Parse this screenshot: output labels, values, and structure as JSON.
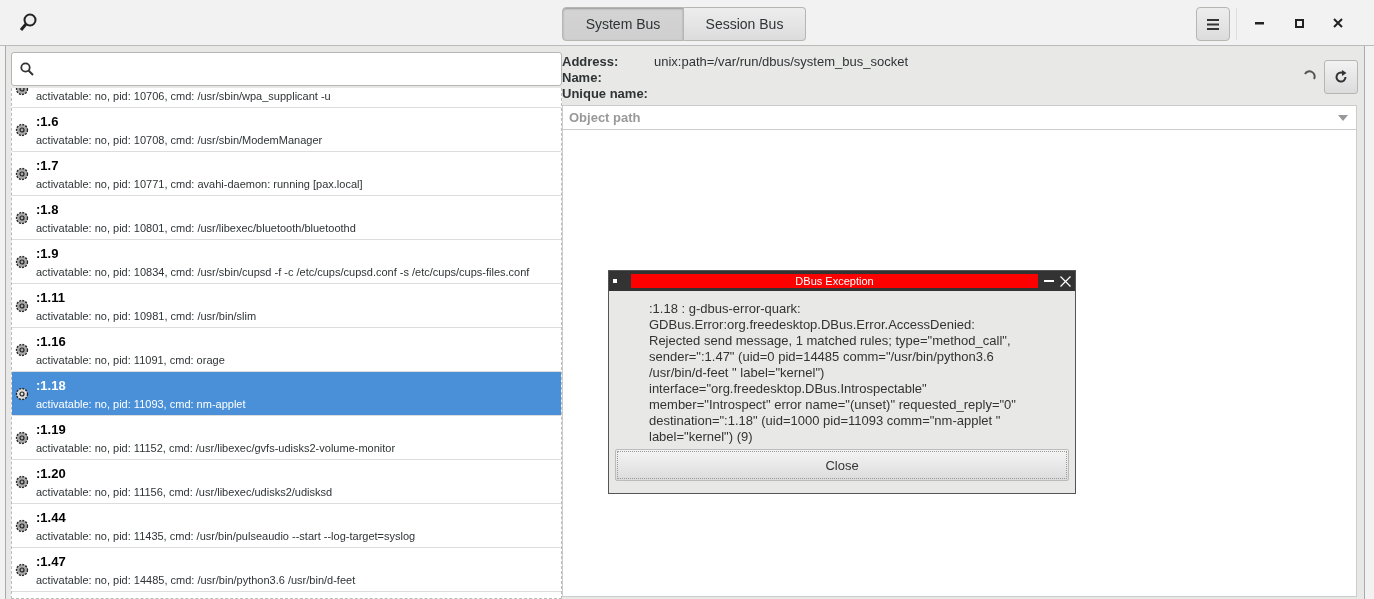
{
  "header": {
    "bus_tabs": [
      {
        "label": "System Bus",
        "selected": true
      },
      {
        "label": "Session Bus",
        "selected": false
      }
    ]
  },
  "bus_list": [
    {
      "detail": "activatable: no, pid: 10706, cmd: /usr/sbin/wpa_supplicant -u",
      "selected": false
    },
    {
      "name": ":1.6",
      "detail": "activatable: no, pid: 10708, cmd: /usr/sbin/ModemManager",
      "selected": false
    },
    {
      "name": ":1.7",
      "detail": "activatable: no, pid: 10771, cmd: avahi-daemon: running [pax.local]",
      "selected": false
    },
    {
      "name": ":1.8",
      "detail": "activatable: no, pid: 10801, cmd: /usr/libexec/bluetooth/bluetoothd",
      "selected": false
    },
    {
      "name": ":1.9",
      "detail": "activatable: no, pid: 10834, cmd: /usr/sbin/cupsd -f -c /etc/cups/cupsd.conf -s /etc/cups/cups-files.conf",
      "selected": false
    },
    {
      "name": ":1.11",
      "detail": "activatable: no, pid: 10981, cmd: /usr/bin/slim",
      "selected": false
    },
    {
      "name": ":1.16",
      "detail": "activatable: no, pid: 11091, cmd: orage",
      "selected": false
    },
    {
      "name": ":1.18",
      "detail": "activatable: no, pid: 11093, cmd: nm-applet",
      "selected": true
    },
    {
      "name": ":1.19",
      "detail": "activatable: no, pid: 11152, cmd: /usr/libexec/gvfs-udisks2-volume-monitor",
      "selected": false
    },
    {
      "name": ":1.20",
      "detail": "activatable: no, pid: 11156, cmd: /usr/libexec/udisks2/udisksd",
      "selected": false
    },
    {
      "name": ":1.44",
      "detail": "activatable: no, pid: 11435, cmd: /usr/bin/pulseaudio --start --log-target=syslog",
      "selected": false
    },
    {
      "name": ":1.47",
      "detail": "activatable: no, pid: 14485, cmd: /usr/bin/python3.6 /usr/bin/d-feet",
      "selected": false
    }
  ],
  "info": [
    {
      "label": "Address:",
      "value": "unix:path=/var/run/dbus/system_bus_socket"
    },
    {
      "label": "Name:"
    },
    {
      "label": "Unique name:"
    }
  ],
  "object_path": {
    "placeholder": "Object path"
  },
  "dialog": {
    "title": "DBus Exception",
    "message": ":1.18 : g-dbus-error-quark: GDBus.Error:org.freedesktop.DBus.Error.AccessDenied: Rejected send message, 1 matched rules; type=\"method_call\", sender=\":1.47\" (uid=0 pid=14485 comm=\"/usr/bin/python3.6 /usr/bin/d-feet \" label=\"kernel\") interface=\"org.freedesktop.DBus.Introspectable\" member=\"Introspect\" error name=\"(unset)\" requested_reply=\"0\" destination=\":1.18\" (uid=1000 pid=11093 comm=\"nm-applet \" label=\"kernel\") (9)",
    "button": "Close"
  }
}
